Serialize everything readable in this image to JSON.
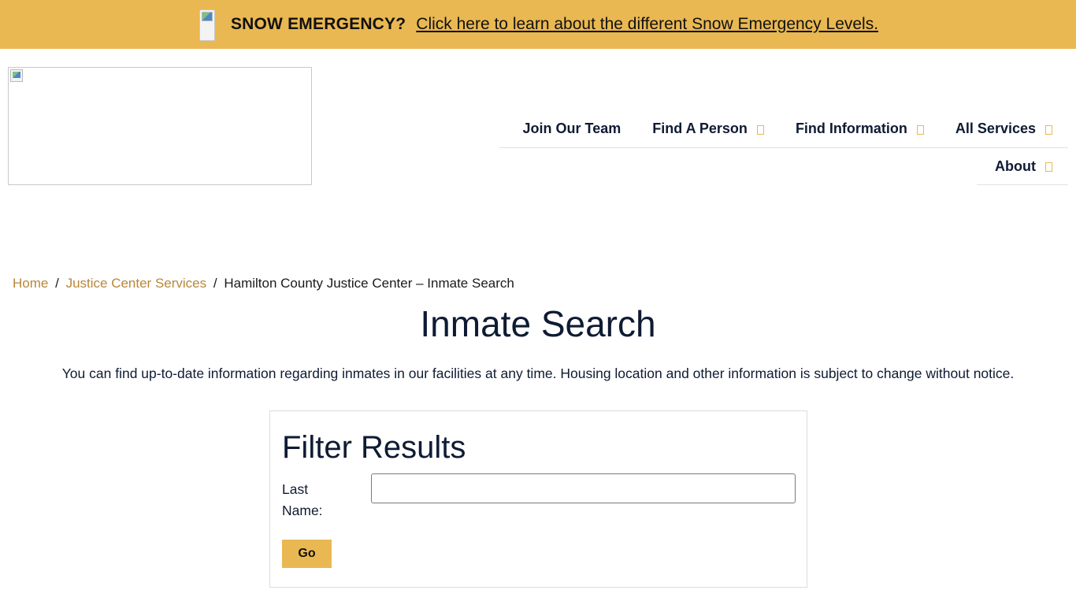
{
  "alert": {
    "icon": "broken-image-icon",
    "title": "SNOW EMERGENCY?",
    "link_text": "Click here to learn about the different Snow Emergency Levels."
  },
  "header": {
    "logo_icon": "broken-image-icon",
    "nav": {
      "join": "Join Our Team",
      "find_person": "Find A Person",
      "find_information": "Find Information",
      "all_services": "All Services",
      "about": "About"
    }
  },
  "breadcrumb": {
    "home": "Home",
    "sep1": "/",
    "section": "Justice Center Services",
    "sep2": "/",
    "current": "Hamilton County Justice Center – Inmate Search"
  },
  "main": {
    "title": "Inmate Search",
    "intro": "You can find up-to-date information regarding inmates in our facilities at any time. Housing location and other information is subject to change without notice."
  },
  "filter": {
    "title": "Filter Results",
    "last_name_label": "Last Name:",
    "last_name_value": "",
    "go_label": "Go"
  },
  "colors": {
    "accent": "#e9b852",
    "link": "#b8873a",
    "text": "#0f1b33"
  }
}
